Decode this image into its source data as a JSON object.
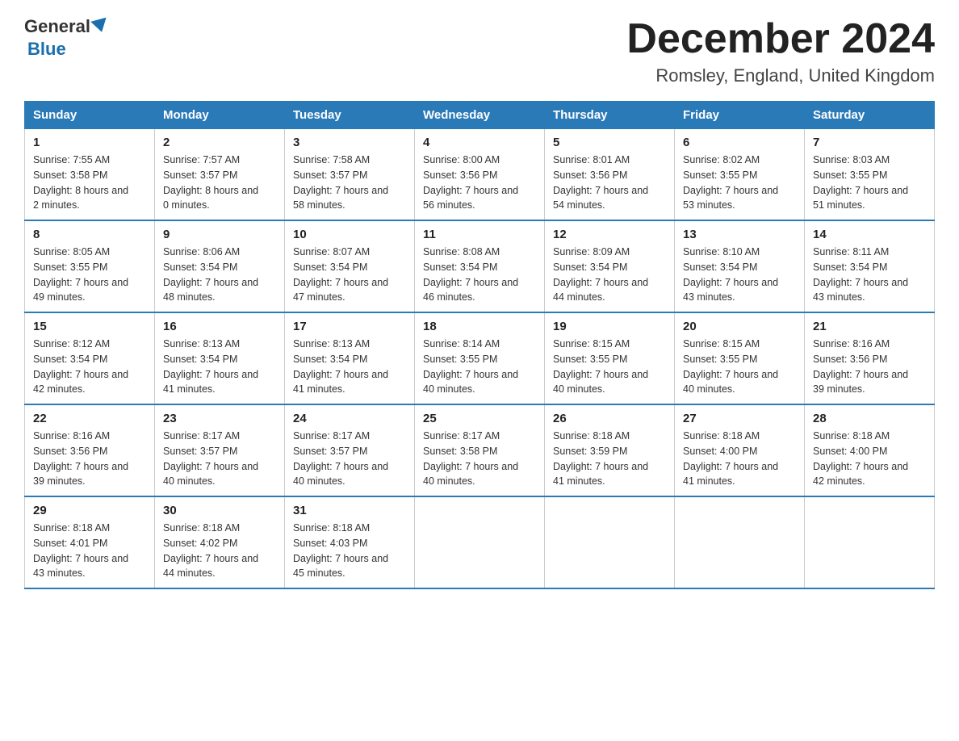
{
  "header": {
    "logo_general": "General",
    "logo_blue": "Blue",
    "month_title": "December 2024",
    "location": "Romsley, England, United Kingdom"
  },
  "days_of_week": [
    "Sunday",
    "Monday",
    "Tuesday",
    "Wednesday",
    "Thursday",
    "Friday",
    "Saturday"
  ],
  "weeks": [
    [
      {
        "day": "1",
        "sunrise": "7:55 AM",
        "sunset": "3:58 PM",
        "daylight": "8 hours and 2 minutes."
      },
      {
        "day": "2",
        "sunrise": "7:57 AM",
        "sunset": "3:57 PM",
        "daylight": "8 hours and 0 minutes."
      },
      {
        "day": "3",
        "sunrise": "7:58 AM",
        "sunset": "3:57 PM",
        "daylight": "7 hours and 58 minutes."
      },
      {
        "day": "4",
        "sunrise": "8:00 AM",
        "sunset": "3:56 PM",
        "daylight": "7 hours and 56 minutes."
      },
      {
        "day": "5",
        "sunrise": "8:01 AM",
        "sunset": "3:56 PM",
        "daylight": "7 hours and 54 minutes."
      },
      {
        "day": "6",
        "sunrise": "8:02 AM",
        "sunset": "3:55 PM",
        "daylight": "7 hours and 53 minutes."
      },
      {
        "day": "7",
        "sunrise": "8:03 AM",
        "sunset": "3:55 PM",
        "daylight": "7 hours and 51 minutes."
      }
    ],
    [
      {
        "day": "8",
        "sunrise": "8:05 AM",
        "sunset": "3:55 PM",
        "daylight": "7 hours and 49 minutes."
      },
      {
        "day": "9",
        "sunrise": "8:06 AM",
        "sunset": "3:54 PM",
        "daylight": "7 hours and 48 minutes."
      },
      {
        "day": "10",
        "sunrise": "8:07 AM",
        "sunset": "3:54 PM",
        "daylight": "7 hours and 47 minutes."
      },
      {
        "day": "11",
        "sunrise": "8:08 AM",
        "sunset": "3:54 PM",
        "daylight": "7 hours and 46 minutes."
      },
      {
        "day": "12",
        "sunrise": "8:09 AM",
        "sunset": "3:54 PM",
        "daylight": "7 hours and 44 minutes."
      },
      {
        "day": "13",
        "sunrise": "8:10 AM",
        "sunset": "3:54 PM",
        "daylight": "7 hours and 43 minutes."
      },
      {
        "day": "14",
        "sunrise": "8:11 AM",
        "sunset": "3:54 PM",
        "daylight": "7 hours and 43 minutes."
      }
    ],
    [
      {
        "day": "15",
        "sunrise": "8:12 AM",
        "sunset": "3:54 PM",
        "daylight": "7 hours and 42 minutes."
      },
      {
        "day": "16",
        "sunrise": "8:13 AM",
        "sunset": "3:54 PM",
        "daylight": "7 hours and 41 minutes."
      },
      {
        "day": "17",
        "sunrise": "8:13 AM",
        "sunset": "3:54 PM",
        "daylight": "7 hours and 41 minutes."
      },
      {
        "day": "18",
        "sunrise": "8:14 AM",
        "sunset": "3:55 PM",
        "daylight": "7 hours and 40 minutes."
      },
      {
        "day": "19",
        "sunrise": "8:15 AM",
        "sunset": "3:55 PM",
        "daylight": "7 hours and 40 minutes."
      },
      {
        "day": "20",
        "sunrise": "8:15 AM",
        "sunset": "3:55 PM",
        "daylight": "7 hours and 40 minutes."
      },
      {
        "day": "21",
        "sunrise": "8:16 AM",
        "sunset": "3:56 PM",
        "daylight": "7 hours and 39 minutes."
      }
    ],
    [
      {
        "day": "22",
        "sunrise": "8:16 AM",
        "sunset": "3:56 PM",
        "daylight": "7 hours and 39 minutes."
      },
      {
        "day": "23",
        "sunrise": "8:17 AM",
        "sunset": "3:57 PM",
        "daylight": "7 hours and 40 minutes."
      },
      {
        "day": "24",
        "sunrise": "8:17 AM",
        "sunset": "3:57 PM",
        "daylight": "7 hours and 40 minutes."
      },
      {
        "day": "25",
        "sunrise": "8:17 AM",
        "sunset": "3:58 PM",
        "daylight": "7 hours and 40 minutes."
      },
      {
        "day": "26",
        "sunrise": "8:18 AM",
        "sunset": "3:59 PM",
        "daylight": "7 hours and 41 minutes."
      },
      {
        "day": "27",
        "sunrise": "8:18 AM",
        "sunset": "4:00 PM",
        "daylight": "7 hours and 41 minutes."
      },
      {
        "day": "28",
        "sunrise": "8:18 AM",
        "sunset": "4:00 PM",
        "daylight": "7 hours and 42 minutes."
      }
    ],
    [
      {
        "day": "29",
        "sunrise": "8:18 AM",
        "sunset": "4:01 PM",
        "daylight": "7 hours and 43 minutes."
      },
      {
        "day": "30",
        "sunrise": "8:18 AM",
        "sunset": "4:02 PM",
        "daylight": "7 hours and 44 minutes."
      },
      {
        "day": "31",
        "sunrise": "8:18 AM",
        "sunset": "4:03 PM",
        "daylight": "7 hours and 45 minutes."
      },
      null,
      null,
      null,
      null
    ]
  ],
  "labels": {
    "sunrise": "Sunrise:",
    "sunset": "Sunset:",
    "daylight": "Daylight:"
  }
}
